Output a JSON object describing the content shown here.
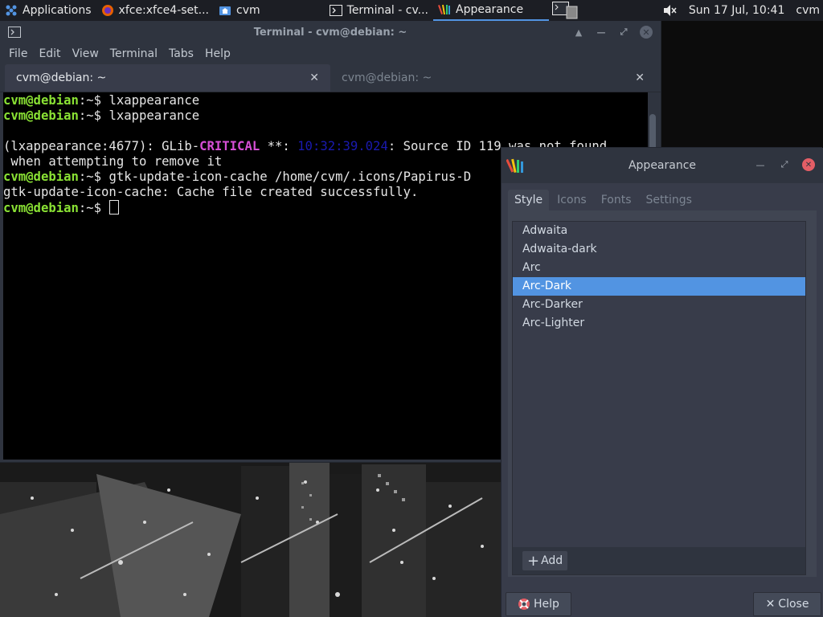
{
  "panel": {
    "tasks": [
      {
        "label": "Applications",
        "icon": "xfce-mouse-icon"
      },
      {
        "label": "xfce:xfce4-set...",
        "icon": "firefox-icon"
      },
      {
        "label": "cvm",
        "icon": "home-folder-icon"
      },
      {
        "label": "Terminal - cv...",
        "icon": "terminal-icon"
      },
      {
        "label": "Appearance",
        "icon": "appearance-icon"
      }
    ],
    "clock": "Sun 17 Jul, 10:41",
    "user": "cvm",
    "volume_icon": "volume-muted-icon"
  },
  "terminal": {
    "title": "Terminal - cvm@debian: ~",
    "menu": [
      "File",
      "Edit",
      "View",
      "Terminal",
      "Tabs",
      "Help"
    ],
    "tabs": [
      {
        "label": "cvm@debian: ~",
        "active": true
      },
      {
        "label": "cvm@debian: ~",
        "active": false
      }
    ],
    "lines": {
      "l1_user": "cvm@debian",
      "l1_rest": ":~$ lxappearance",
      "l2_user": "cvm@debian",
      "l2_rest": ":~$ lxappearance",
      "l3_a": "(lxappearance:4677): GLib-",
      "l3_crit": "CRITICAL",
      "l3_b": " **: ",
      "l3_ts": "10:32:39.024",
      "l3_c": ": Source ID 119 was not found",
      "l4": " when attempting to remove it",
      "l5_user": "cvm@debian",
      "l5_rest": ":~$ gtk-update-icon-cache /home/cvm/.icons/Papirus-D",
      "l6": "gtk-update-icon-cache: Cache file created successfully.",
      "l7_user": "cvm@debian",
      "l7_rest": ":~$ "
    }
  },
  "appearance": {
    "title": "Appearance",
    "tabs": [
      "Style",
      "Icons",
      "Fonts",
      "Settings"
    ],
    "themes": [
      "Adwaita",
      "Adwaita-dark",
      "Arc",
      "Arc-Dark",
      "Arc-Darker",
      "Arc-Lighter"
    ],
    "selected_theme": "Arc-Dark",
    "add_label": "Add",
    "help_label": "Help",
    "close_label": "Close"
  },
  "colors": {
    "accent": "#5294e2",
    "prompt": "#8ae234",
    "critical": "#d64fd6",
    "close_red": "#e45e66"
  }
}
